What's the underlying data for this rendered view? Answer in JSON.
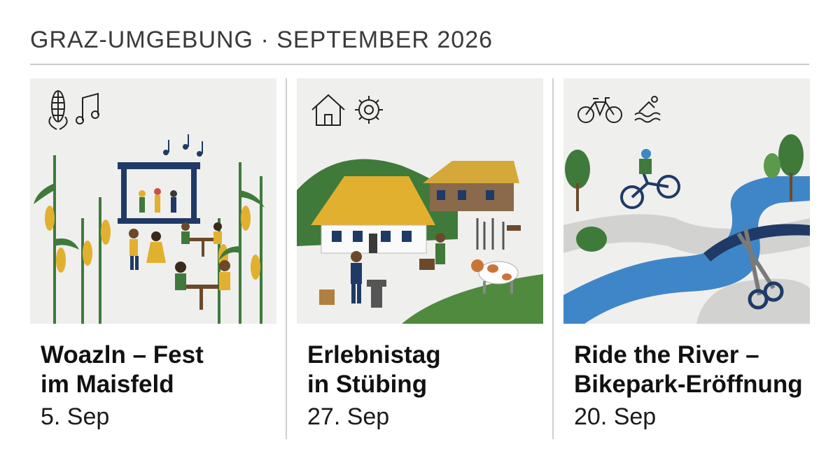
{
  "header": {
    "title": "GRAZ-UMGEBUNG · SEPTEMBER 2026"
  },
  "events": [
    {
      "title_line1": "Woazln – Fest",
      "title_line2": "im Maisfeld",
      "date": "5. Sep",
      "icons": [
        "corn-icon",
        "music-note-icon"
      ]
    },
    {
      "title_line1": "Erlebnistag",
      "title_line2": "in Stübing",
      "date": "27. Sep",
      "icons": [
        "house-icon",
        "gear-icon"
      ]
    },
    {
      "title_line1": "Ride the River –",
      "title_line2": "Bikepark-Eröffnung",
      "date": "20. Sep",
      "icons": [
        "bicycle-icon",
        "swimmer-icon"
      ]
    }
  ],
  "colors": {
    "navy": "#1f3a66",
    "green": "#3f7a3a",
    "corn_yellow": "#e2b02f",
    "river_blue": "#3f86c8",
    "background": "#efefed"
  }
}
